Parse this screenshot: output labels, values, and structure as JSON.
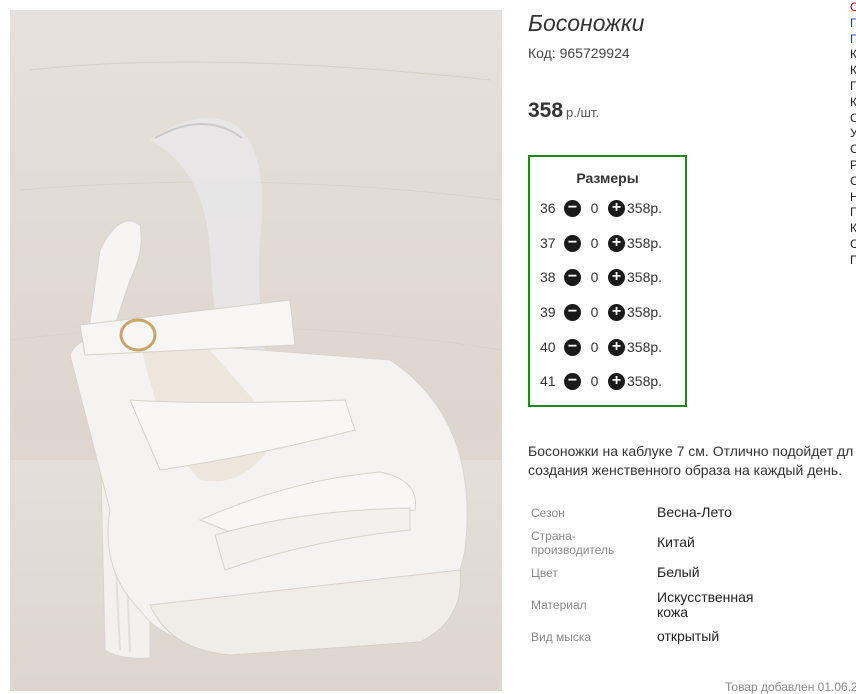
{
  "product": {
    "title": "Босоножки",
    "code": "Код: 965729924",
    "price_value": "358",
    "price_unit": "р./шт."
  },
  "sizes": {
    "title": "Размеры",
    "rows": [
      {
        "size": "36",
        "qty": "0",
        "price": "358р."
      },
      {
        "size": "37",
        "qty": "0",
        "price": "358р."
      },
      {
        "size": "38",
        "qty": "0",
        "price": "358р."
      },
      {
        "size": "39",
        "qty": "0",
        "price": "358р."
      },
      {
        "size": "40",
        "qty": "0",
        "price": "358р."
      },
      {
        "size": "41",
        "qty": "0",
        "price": "358р."
      }
    ],
    "minus_glyph": "−",
    "plus_glyph": "+"
  },
  "description": {
    "line1": "Босоножки на каблуке 7 см. Отлично подойдет дл",
    "line2": "создания женственного образа на каждый день."
  },
  "attributes": [
    {
      "label": "Сезон",
      "value": "Весна-Лето"
    },
    {
      "label": "Страна-\nпроизводитель",
      "value": "Китай"
    },
    {
      "label": "Цвет",
      "value": "Белый"
    },
    {
      "label": "Материал",
      "value": "Искусственная\nкожа"
    },
    {
      "label": "Вид мыска",
      "value": "открытый"
    }
  ],
  "footer": {
    "added": "Товар добавлен 01.06.2"
  },
  "edge_letters": [
    "С",
    "Г",
    "Г",
    "К",
    "К",
    "Г",
    "К",
    "С",
    "У",
    "С",
    "Р",
    "С",
    "Н",
    "Г",
    "К",
    "С",
    "П"
  ],
  "colors": {
    "sizes_border": "#1a8c1a",
    "edge_red": "#cc0000",
    "edge_blue": "#1a3fb0"
  }
}
